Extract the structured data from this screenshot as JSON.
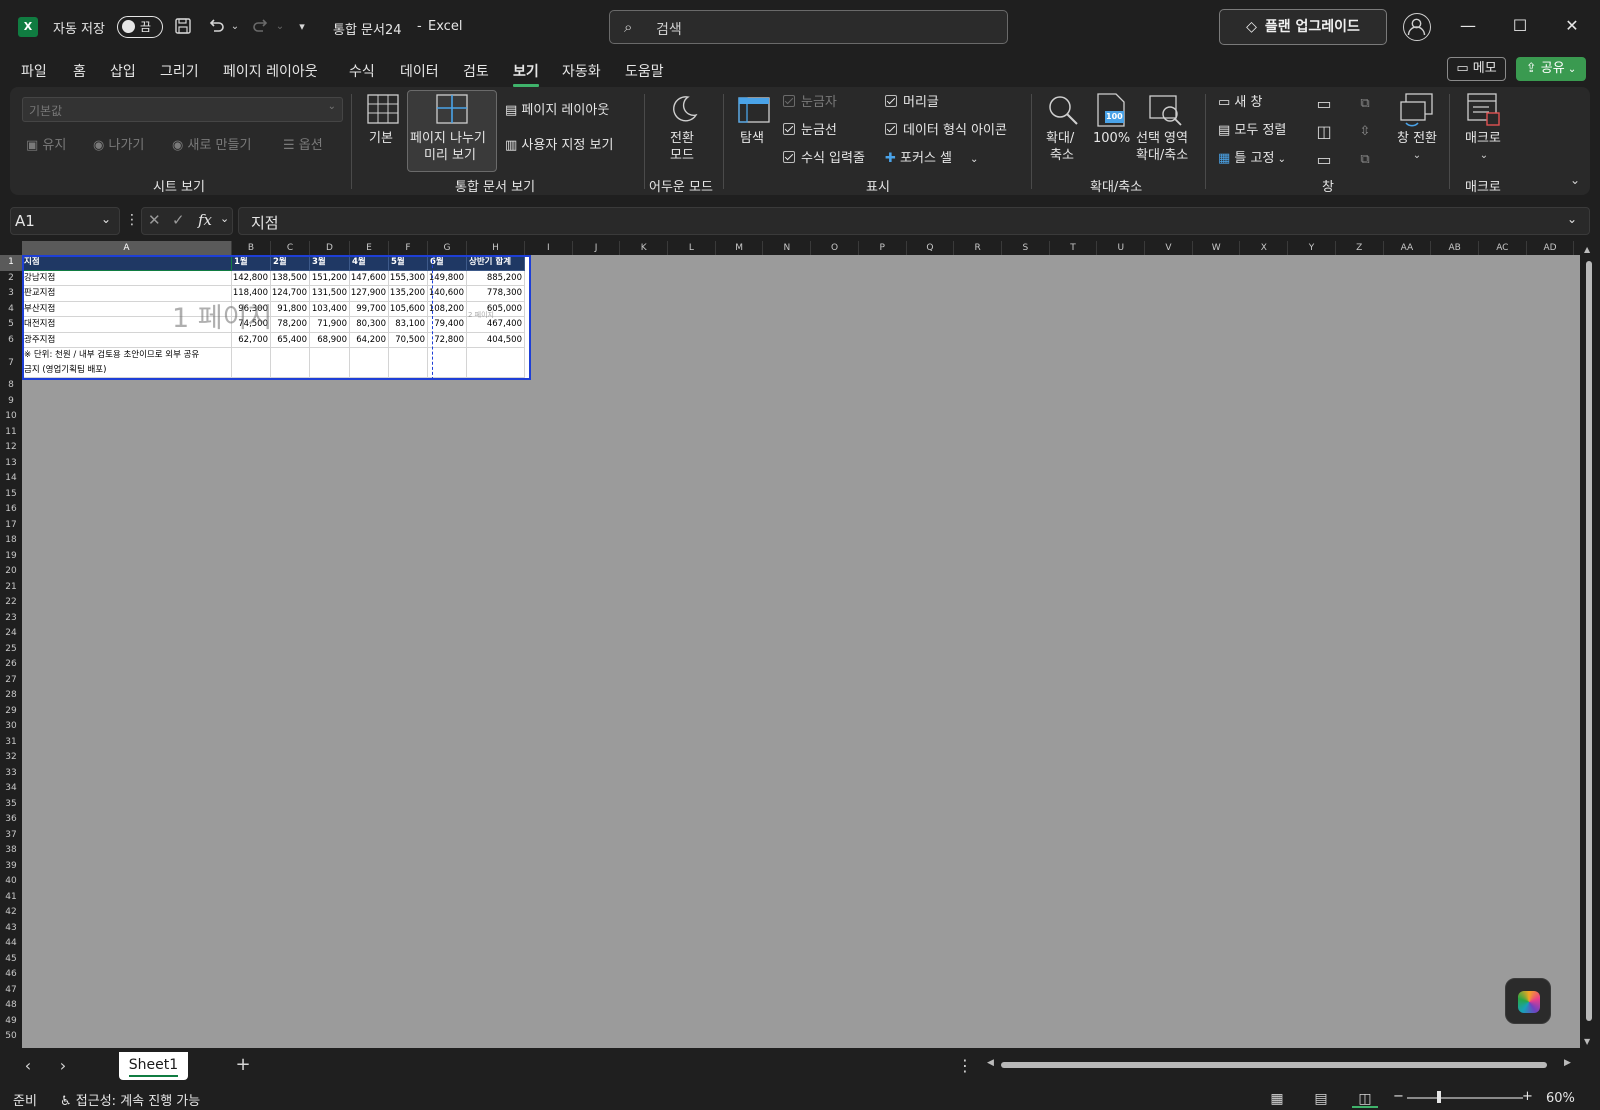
{
  "app": {
    "autosave_label": "자동 저장",
    "autosave_state": "끔",
    "doc_title": "통합 문서24",
    "title_sep": "-",
    "app_name": "Excel",
    "search_placeholder": "검색",
    "upgrade_label": "플랜 업그레이드",
    "memo_label": "메모",
    "share_label": "공유"
  },
  "menu": [
    "파일",
    "홈",
    "삽입",
    "그리기",
    "페이지 레이아웃",
    "수식",
    "데이터",
    "검토",
    "보기",
    "자동화",
    "도움말"
  ],
  "ribbon": {
    "sheet_view": {
      "view_select": "기본값",
      "keep": "유지",
      "exit": "나가기",
      "new": "새로 만들기",
      "options": "옵션",
      "group": "시트 보기"
    },
    "workbook_view": {
      "normal": "기본",
      "page_break_1": "페이지 나누기",
      "page_break_2": "미리 보기",
      "page_layout": "페이지 레이아웃",
      "custom": "사용자 지정 보기",
      "group": "통합 문서 보기"
    },
    "dark_mode": {
      "switch_1": "전환",
      "switch_2": "모드",
      "group": "어두운 모드"
    },
    "show": {
      "navigate": "탐색",
      "ruler": "눈금자",
      "gridlines": "눈금선",
      "formula_bar": "수식 입력줄",
      "headings": "머리글",
      "data_format_icons": "데이터 형식 아이콘",
      "focus_cell": "포커스 셀",
      "group": "표시"
    },
    "zoom": {
      "zoom_1": "확대/",
      "zoom_2": "축소",
      "zoom100": "100%",
      "sel_1": "선택 영역",
      "sel_2": "확대/축소",
      "group": "확대/축소",
      "icon_100": "100"
    },
    "window": {
      "new_window": "새 창",
      "arrange_all": "모두 정렬",
      "freeze": "틀 고정",
      "switch_windows": "창 전환",
      "group": "창"
    },
    "macros": {
      "macro": "매크로",
      "group": "매크로"
    }
  },
  "formula": {
    "name_box": "A1",
    "content": "지점"
  },
  "columns": [
    "A",
    "B",
    "C",
    "D",
    "E",
    "F",
    "G",
    "H",
    "I",
    "J",
    "K",
    "L",
    "M",
    "N",
    "O",
    "P",
    "Q",
    "R",
    "S",
    "T",
    "U",
    "V",
    "W",
    "X",
    "Y",
    "Z",
    "AA",
    "AB",
    "AC",
    "AD"
  ],
  "rows": [
    "1",
    "2",
    "3",
    "4",
    "5",
    "6",
    "7",
    "8",
    "9",
    "10",
    "11",
    "12",
    "13",
    "14",
    "15",
    "16",
    "17",
    "18",
    "19",
    "20",
    "21",
    "22",
    "23",
    "24",
    "25",
    "26",
    "27",
    "28",
    "29",
    "30",
    "31",
    "32",
    "33",
    "34",
    "35",
    "36",
    "37",
    "38",
    "39",
    "40",
    "41",
    "42",
    "43",
    "44",
    "45",
    "46",
    "47",
    "48",
    "49",
    "50"
  ],
  "table": {
    "headers": [
      "지점",
      "1월",
      "2월",
      "3월",
      "4월",
      "5월",
      "6월",
      "상반기 합계"
    ],
    "rows": [
      [
        "강남지점",
        "142,800",
        "138,500",
        "151,200",
        "147,600",
        "155,300",
        "149,800",
        "885,200"
      ],
      [
        "판교지점",
        "118,400",
        "124,700",
        "131,500",
        "127,900",
        "135,200",
        "140,600",
        "778,300"
      ],
      [
        "부산지점",
        "96,300",
        "91,800",
        "103,400",
        "99,700",
        "105,600",
        "108,200",
        "605,000"
      ],
      [
        "대전지점",
        "74,500",
        "78,200",
        "71,900",
        "80,300",
        "83,100",
        "79,400",
        "467,400"
      ],
      [
        "광주지점",
        "62,700",
        "65,400",
        "68,900",
        "64,200",
        "70,500",
        "72,800",
        "404,500"
      ]
    ],
    "note_1": "※ 단위: 천원 / 내부 검토용 초안이므로 외부 공유",
    "note_2": "금지 (영업기획팀 배포)"
  },
  "page_watermark": "1 페이지",
  "page_watermark_2": "2 페이지",
  "sheet_tab": "Sheet1",
  "status": {
    "ready": "준비",
    "accessibility": "접근성: 계속 진행 가능",
    "zoom": "60%"
  },
  "colors": {
    "accent": "#107c41",
    "header_fill": "#1f3864",
    "page_border": "#1e3fd6",
    "share": "#3a9a50"
  }
}
